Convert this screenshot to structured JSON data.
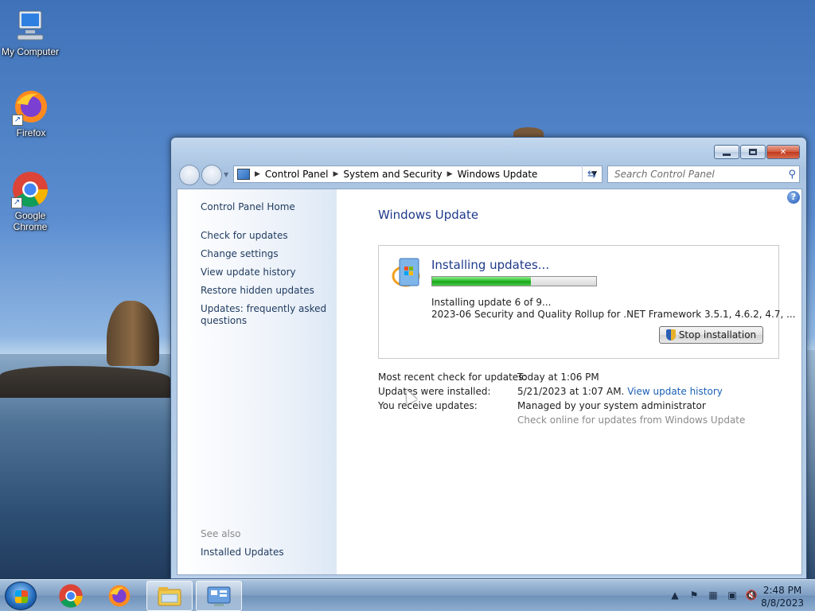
{
  "desktop": {
    "icons": [
      {
        "label": "My Computer",
        "icon": "computer-icon"
      },
      {
        "label": "Firefox",
        "icon": "firefox-icon"
      },
      {
        "label": "Google Chrome",
        "icon": "chrome-icon"
      }
    ]
  },
  "window": {
    "controls": {
      "minimize": "minimize",
      "maximize": "maximize",
      "close": "close"
    },
    "address": {
      "segments": [
        "Control Panel",
        "System and Security",
        "Windows Update"
      ]
    },
    "search": {
      "placeholder": "Search Control Panel"
    },
    "left_pane": {
      "home": "Control Panel Home",
      "links": [
        "Check for updates",
        "Change settings",
        "View update history",
        "Restore hidden updates",
        "Updates: frequently asked questions"
      ],
      "see_also": "See also",
      "installed_updates": "Installed Updates"
    },
    "main": {
      "title": "Windows Update",
      "panel": {
        "heading": "Installing updates...",
        "progress": 0.6,
        "status": "Installing update 6 of 9...",
        "update_name": "2023-06 Security and Quality Rollup for .NET Framework 3.5.1, 4.6.2, 4.7, ...",
        "stop_button": "Stop installation"
      },
      "info": {
        "recent_check_label": "Most recent check for updates:",
        "recent_check_value": "Today at 1:06 PM",
        "installed_label": "Updates were installed:",
        "installed_value": "5/21/2023 at 1:07 AM.",
        "history_link": "View update history",
        "receive_label": "You receive updates:",
        "receive_value": "Managed by your system administrator",
        "check_online": "Check online for updates from Windows Update"
      }
    }
  },
  "taskbar": {
    "clock_time": "2:48 PM",
    "clock_date": "8/8/2023"
  },
  "colors": {
    "accent": "#1e3a8a",
    "link": "#1a5fb4",
    "progress": "#28b828"
  }
}
